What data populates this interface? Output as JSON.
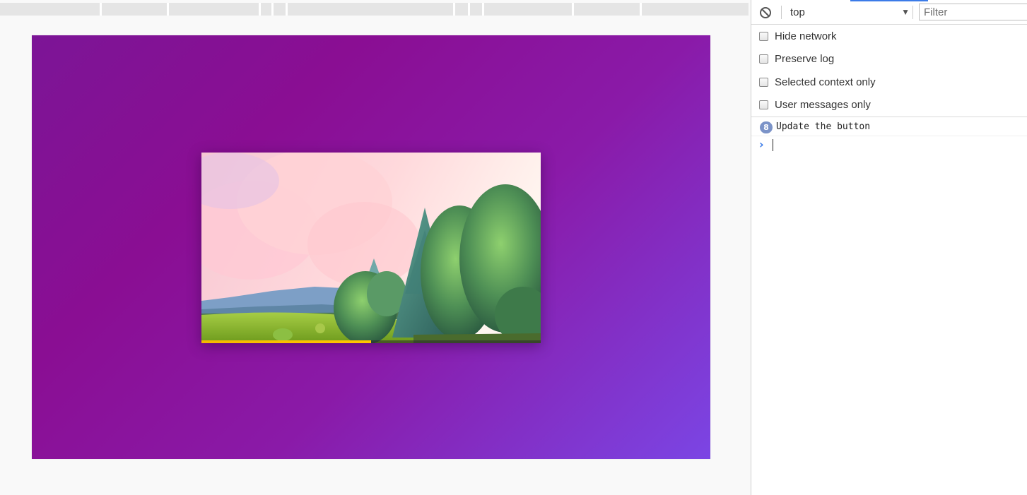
{
  "viewport": {
    "accent_colors": [
      "#7c1596",
      "#8a0e93",
      "#7b45e4"
    ],
    "video": {
      "scene": "illustration-clouds-hills-trees",
      "progress": 0.5,
      "progress_color": "#ffc600"
    }
  },
  "devtools": {
    "toolbar": {
      "clear_icon": "block-icon",
      "context": "top",
      "context_arrow": "▼",
      "filter_placeholder": "Filter"
    },
    "settings": [
      {
        "label": "Hide network",
        "checked": false
      },
      {
        "label": "Preserve log",
        "checked": false
      },
      {
        "label": "Selected context only",
        "checked": false
      },
      {
        "label": "User messages only",
        "checked": false
      }
    ],
    "log": {
      "count": "8",
      "message": "Update the button"
    },
    "prompt_symbol": "›",
    "accent_color": "#3b7be8"
  }
}
